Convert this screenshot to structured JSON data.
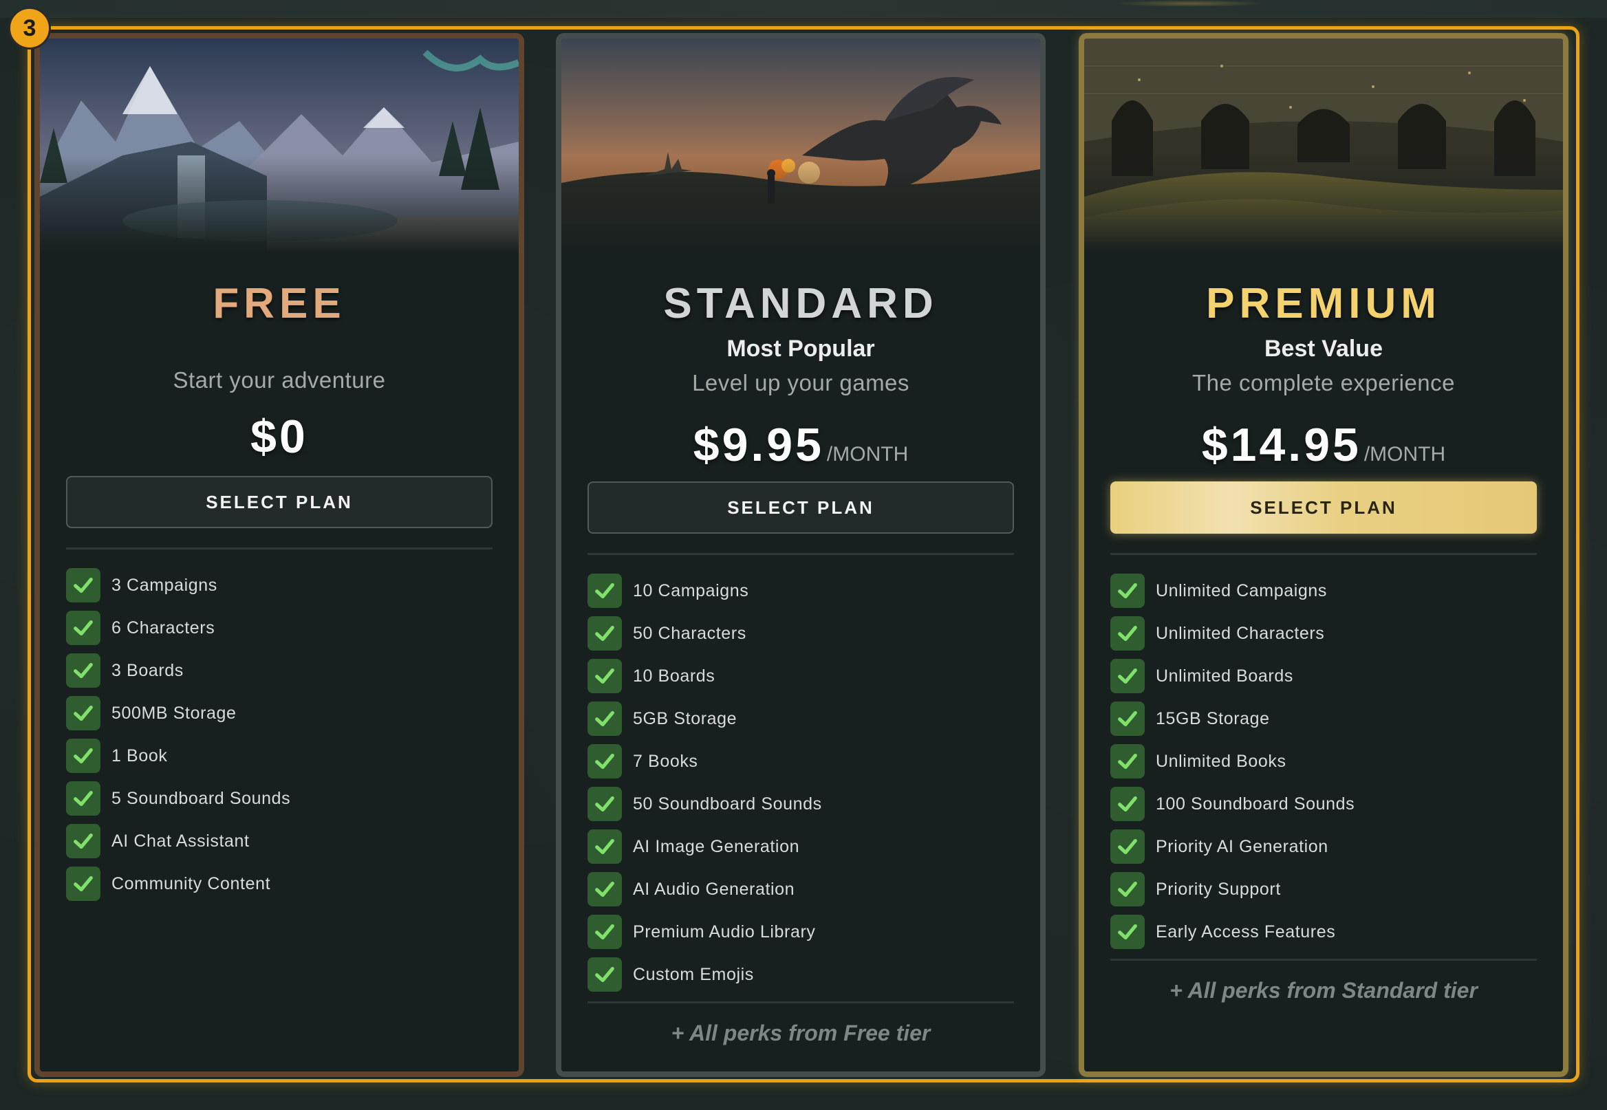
{
  "step_badge": "3",
  "plans": [
    {
      "id": "free",
      "title": "FREE",
      "badge": "",
      "tagline": "Start your adventure",
      "price": "$0",
      "period": "",
      "button_label": "SELECT PLAN",
      "features": [
        "3 Campaigns",
        "6 Characters",
        "3 Boards",
        "500MB Storage",
        "1 Book",
        "5 Soundboard Sounds",
        "AI Chat Assistant",
        "Community Content"
      ],
      "perks_note": "",
      "accent_color": "#e2a97c"
    },
    {
      "id": "standard",
      "title": "STANDARD",
      "badge": "Most Popular",
      "tagline": "Level up your games",
      "price": "$9.95",
      "period": "/MONTH",
      "button_label": "SELECT PLAN",
      "features": [
        "10 Campaigns",
        "50 Characters",
        "10 Boards",
        "5GB Storage",
        "7 Books",
        "50 Soundboard Sounds",
        "AI Image Generation",
        "AI Audio Generation",
        "Premium Audio Library",
        "Custom Emojis"
      ],
      "perks_note": "+ All perks from Free tier",
      "accent_color": "#d2d5d5"
    },
    {
      "id": "premium",
      "title": "PREMIUM",
      "badge": "Best Value",
      "tagline": "The complete experience",
      "price": "$14.95",
      "period": "/MONTH",
      "button_label": "SELECT PLAN",
      "features": [
        "Unlimited Campaigns",
        "Unlimited Characters",
        "Unlimited Boards",
        "15GB Storage",
        "Unlimited Books",
        "100 Soundboard Sounds",
        "Priority AI Generation",
        "Priority Support",
        "Early Access Features"
      ],
      "perks_note": "+ All perks from Standard tier",
      "accent_color": "#f4d36f"
    }
  ],
  "icons": {
    "check": "checkmark-icon"
  },
  "colors": {
    "frame_highlight": "#e8a319",
    "check_bg": "#2f5d30",
    "check_mark": "#7fe06a",
    "premium_button": "#e9cf7e"
  }
}
